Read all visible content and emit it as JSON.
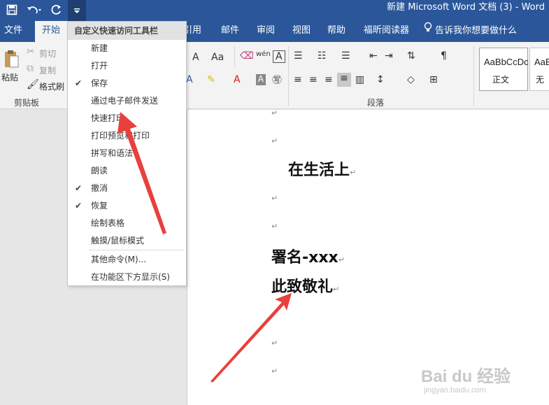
{
  "window": {
    "title": "新建 Microsoft Word 文档 (3)  -  Word"
  },
  "qat": {
    "save_icon": "save-icon",
    "undo_icon": "undo-icon",
    "redo_icon": "redo-icon",
    "customize_icon": "customize-qat-icon"
  },
  "tabs": [
    "文件",
    "开始",
    "引用",
    "邮件",
    "审阅",
    "视图",
    "帮助",
    "福昕阅读器"
  ],
  "tell_me": "告诉我你想要做什么",
  "ribbon": {
    "clipboard": {
      "paste": "粘贴",
      "cut": "剪切",
      "copy": "复制",
      "format_painter": "格式刷",
      "label": "剪贴板"
    },
    "font": {
      "grow": "A",
      "case": "Aa",
      "wen": "wén",
      "border_a": "A"
    },
    "paragraph": {
      "label": "段落"
    },
    "styles": [
      {
        "sample": "AaBbCcDc",
        "name": "正文"
      },
      {
        "sample": "AaBb",
        "name": "无"
      }
    ]
  },
  "menu": {
    "header": "自定义快速访问工具栏",
    "items": [
      {
        "label": "新建",
        "checked": false
      },
      {
        "label": "打开",
        "checked": false
      },
      {
        "label": "保存",
        "checked": true
      },
      {
        "label": "通过电子邮件发送",
        "checked": false
      },
      {
        "label": "快速打印",
        "checked": false
      },
      {
        "label": "打印预览和打印",
        "checked": false
      },
      {
        "label": "拼写和语法",
        "checked": false
      },
      {
        "label": "朗读",
        "checked": false
      },
      {
        "label": "撤消",
        "checked": true
      },
      {
        "label": "恢复",
        "checked": true
      },
      {
        "label": "绘制表格",
        "checked": false
      },
      {
        "label": "触摸/鼠标模式",
        "checked": false
      }
    ],
    "more": "其他命令(M)...",
    "below": "在功能区下方显示(S)",
    "check_mark": "✔"
  },
  "document": {
    "lines": [
      "在生活上",
      "署名-xxx",
      "此致敬礼"
    ],
    "para_mark": "↵"
  },
  "watermark": {
    "main": "Bai du 经验",
    "sub": "jingyan.baidu.com"
  },
  "colors": {
    "accent": "#2b579a",
    "arrow": "#e8403d"
  }
}
